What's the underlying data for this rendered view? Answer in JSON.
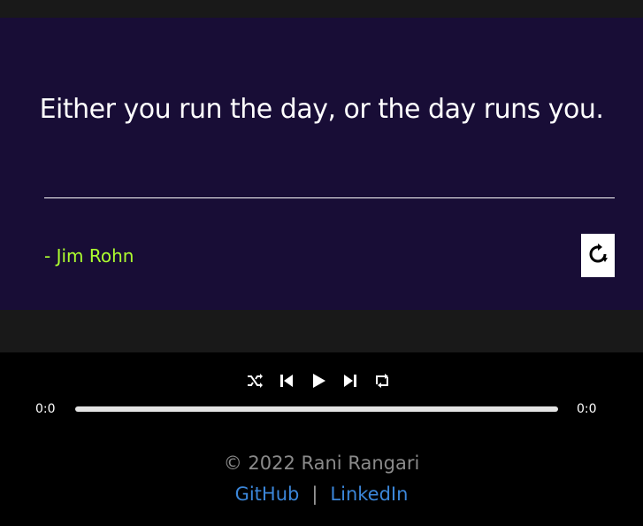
{
  "quote": {
    "text": "Either you run the day, or the day runs you.",
    "author": "- Jim Rohn"
  },
  "player": {
    "current_time": "0:0",
    "duration": "0:0",
    "progress": 0
  },
  "footer": {
    "copyright": "© 2022 Rani Rangari",
    "separator": "|",
    "links": [
      "GitHub",
      "LinkedIn"
    ]
  },
  "icons": {
    "refresh": "refresh-icon",
    "shuffle": "shuffle-icon",
    "previous": "skip-previous-icon",
    "play": "play-icon",
    "next": "skip-next-icon",
    "repeat": "repeat-icon"
  },
  "colors": {
    "card_background": "#180d36",
    "author": "#adff2f",
    "link": "#3b86d9"
  }
}
